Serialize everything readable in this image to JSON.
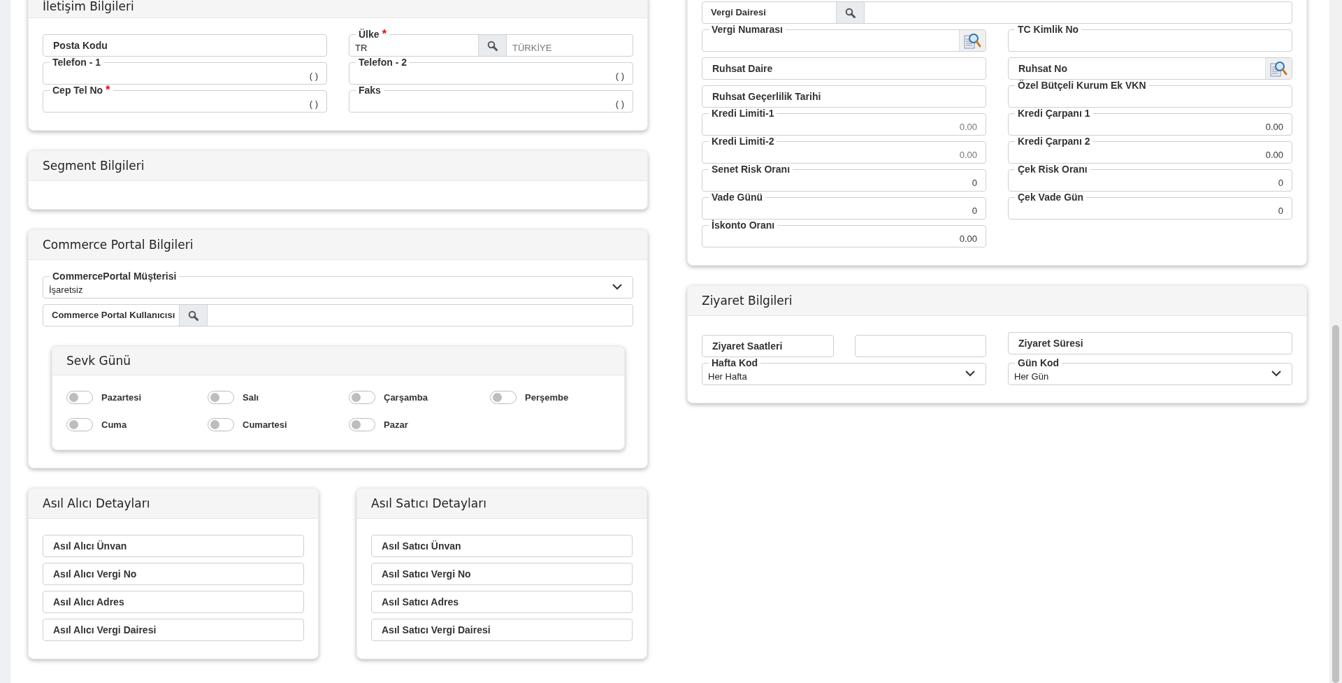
{
  "columns": [
    {
      "panels": [
        {
          "title": "İletişim Bilgileri",
          "rows": [
            [
              {
                "kind": "inline",
                "label": "Posta Kodu"
              },
              {
                "kind": "legend-lookup",
                "label": "Ülke",
                "mark": "*",
                "value": "TR",
                "description": "TÜRKİYE"
              }
            ],
            [
              {
                "kind": "legend",
                "label": "Telefon - 1",
                "value": "( )"
              },
              {
                "kind": "legend",
                "label": "Telefon - 2",
                "value": "( )"
              }
            ],
            [
              {
                "kind": "legend",
                "label": "Cep Tel No",
                "mark": "*",
                "value": "( )"
              },
              {
                "kind": "legend",
                "label": "Faks",
                "value": "( )"
              }
            ]
          ]
        },
        {
          "title": "Segment Bilgileri"
        },
        {
          "title": "Commerce Portal Bilgileri",
          "rows": [
            [
              {
                "kind": "select",
                "label": "CommercePortal Müşterisi",
                "value": "İşaretsiz"
              }
            ],
            [
              {
                "kind": "lookup",
                "label": "Commerce Portal Kullanıcısı"
              }
            ]
          ],
          "card": {
            "title": "Sevk Günü",
            "switches": [
              {
                "label": "Pazartesi",
                "on": false
              },
              {
                "label": "Salı",
                "on": false
              },
              {
                "label": "Çarşamba",
                "on": false
              },
              {
                "label": "Perşembe",
                "on": false
              },
              {
                "label": "Cuma",
                "on": false
              },
              {
                "label": "Cumartesi",
                "on": false
              },
              {
                "label": "Pazar",
                "on": false
              }
            ]
          }
        }
      ],
      "side_by_side": [
        {
          "title": "Asıl Alıcı Detayları",
          "rows": [
            [
              {
                "kind": "inline",
                "label": "Asıl Alıcı Ünvan"
              }
            ],
            [
              {
                "kind": "inline",
                "label": "Asıl Alıcı Vergi No"
              }
            ],
            [
              {
                "kind": "inline",
                "label": "Asıl Alıcı Adres"
              }
            ],
            [
              {
                "kind": "inline",
                "label": "Asıl Alıcı Vergi Dairesi"
              }
            ]
          ]
        },
        {
          "title": "Asıl Satıcı Detayları",
          "rows": [
            [
              {
                "kind": "inline",
                "label": "Asıl Satıcı Ünvan"
              }
            ],
            [
              {
                "kind": "inline",
                "label": "Asıl Satıcı Vergi No"
              }
            ],
            [
              {
                "kind": "inline",
                "label": "Asıl Satıcı Adres"
              }
            ],
            [
              {
                "kind": "inline",
                "label": "Asıl Satıcı Vergi Dairesi"
              }
            ]
          ]
        }
      ]
    },
    {
      "panels": [
        {
          "rows": [
            [
              {
                "kind": "lookup",
                "label": "Vergi Dairesi"
              }
            ],
            [
              {
                "kind": "legend",
                "label": "Vergi Numarası",
                "lookup_button": true
              },
              {
                "kind": "legend",
                "label": "TC Kimlik No"
              }
            ],
            [
              {
                "kind": "inline",
                "label": "Ruhsat Daire"
              },
              {
                "kind": "inline",
                "label": "Ruhsat No",
                "lookup_button": true
              }
            ],
            [
              {
                "kind": "inline",
                "label": "Ruhsat Geçerlilik Tarihi"
              },
              {
                "kind": "legend",
                "label": "Özel Bütçeli Kurum Ek VKN"
              }
            ],
            [
              {
                "kind": "legend",
                "label": "Kredi Limiti-1",
                "placeholder": "0.00"
              },
              {
                "kind": "legend",
                "label": "Kredi Çarpanı 1",
                "value": "0.00"
              }
            ],
            [
              {
                "kind": "legend",
                "label": "Kredi Limiti-2",
                "placeholder": "0.00"
              },
              {
                "kind": "legend",
                "label": "Kredi Çarpanı 2",
                "value": "0.00"
              }
            ],
            [
              {
                "kind": "legend",
                "label": "Senet Risk Oranı",
                "value": "0"
              },
              {
                "kind": "legend",
                "label": "Çek Risk Oranı",
                "value": "0"
              }
            ],
            [
              {
                "kind": "legend",
                "label": "Vade Günü",
                "value": "0"
              },
              {
                "kind": "legend",
                "label": "Çek Vade Gün",
                "value": "0"
              }
            ],
            [
              {
                "kind": "legend",
                "label": "İskonto Oranı",
                "value": "0.00"
              }
            ]
          ]
        },
        {
          "title": "Ziyaret Bilgileri",
          "rows": [
            [
              {
                "kind": "range",
                "label": "Ziyaret Saatleri"
              },
              {
                "kind": "inline",
                "label": "Ziyaret Süresi"
              }
            ],
            [
              {
                "kind": "select",
                "label": "Hafta Kod",
                "value": "Her Hafta"
              },
              {
                "kind": "select",
                "label": "Gün Kod",
                "value": "Her Gün"
              }
            ]
          ]
        }
      ]
    }
  ]
}
